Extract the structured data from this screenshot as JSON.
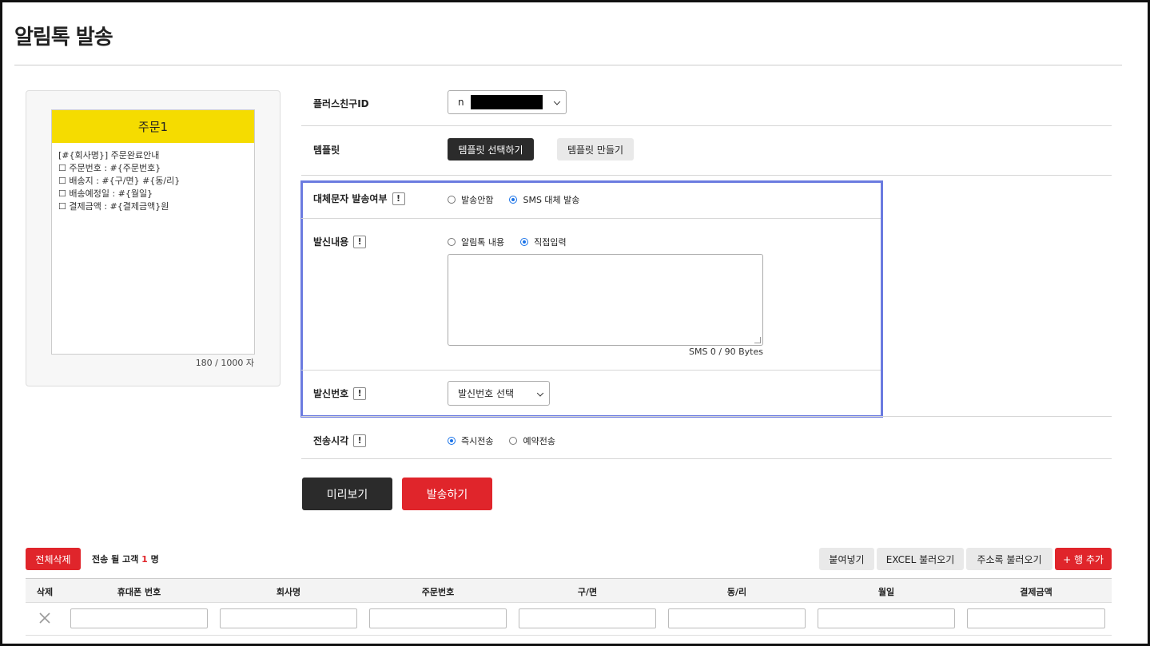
{
  "page": {
    "title": "알림톡 발송"
  },
  "preview": {
    "header": "주문1",
    "lines": [
      "[#{회사명}] 주문완료안내",
      "☐ 주문번호 : #{주문번호}",
      "☐ 배송지 : #{구/면} #{동/리}",
      "☐ 배송예정일 : #{월일}",
      "☐ 결제금액 : #{결제금액}원"
    ],
    "char_count": "180 / 1000 자"
  },
  "form": {
    "plus_friend_label": "플러스친구ID",
    "plus_friend_value": "n",
    "template_label": "템플릿",
    "select_template_button": "템플릿 선택하기",
    "create_template_button": "템플릿 만들기",
    "alt_sms_label": "대체문자 발송여부",
    "alt_sms_options": [
      "발송안함",
      "SMS 대체 발송"
    ],
    "alt_sms_selected": "SMS 대체 발송",
    "content_label": "발신내용",
    "content_options": [
      "알림톡 내용",
      "직접입력"
    ],
    "content_selected": "직접입력",
    "content_value": "",
    "byte_counter": "SMS 0 / 90 Bytes",
    "sender_label": "발신번호",
    "sender_select": "발신번호 선택",
    "send_time_label": "전송시각",
    "send_time_options": [
      "즉시전송",
      "예약전송"
    ],
    "send_time_selected": "즉시전송",
    "info_icon": "!"
  },
  "actions": {
    "preview_button": "미리보기",
    "send_button": "발송하기"
  },
  "customers": {
    "delete_all_button": "전체삭제",
    "count_prefix": "전송 될 고객",
    "count": "1",
    "count_suffix": "명",
    "paste_button": "붙여넣기",
    "excel_button": "EXCEL 불러오기",
    "addressbook_button": "주소록 불러오기",
    "add_row_button": "+ 행 추가",
    "columns": [
      "삭제",
      "휴대폰 번호",
      "회사명",
      "주문번호",
      "구/면",
      "동/리",
      "월일",
      "결제금액"
    ]
  },
  "colors": {
    "accent_red": "#e0252b",
    "highlight_blue": "#6b7be0",
    "kakao_yellow": "#f5dc00",
    "dark_button": "#2b2b2b"
  }
}
